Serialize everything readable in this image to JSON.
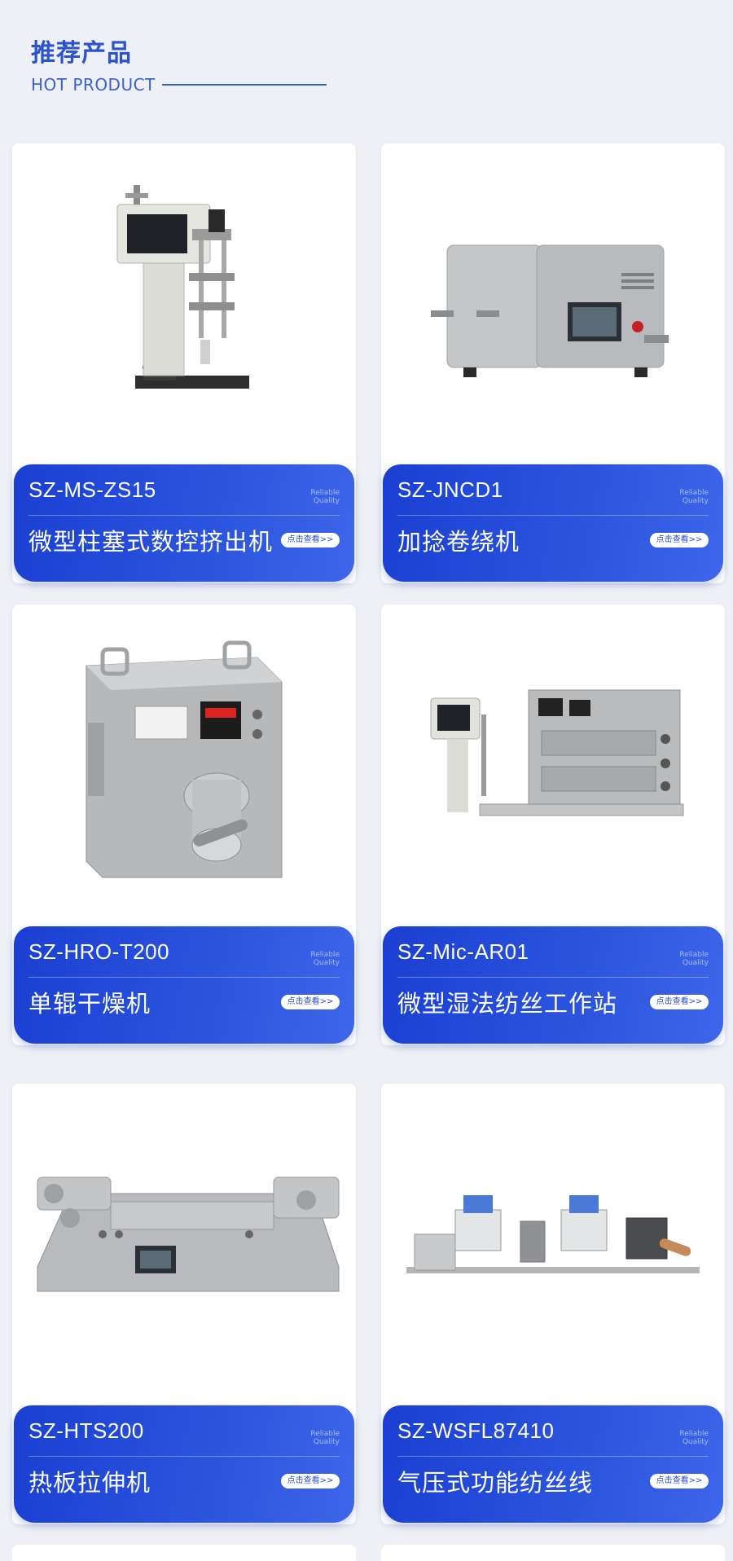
{
  "section": {
    "title_cn": "推荐产品",
    "title_en": "HOT PRODUCT"
  },
  "products": [
    {
      "model": "SZ-MS-ZS15",
      "name": "微型柱塞式数控挤出机",
      "tag_line1": "Reliable",
      "tag_line2": "Quality",
      "button": "点击查看>>"
    },
    {
      "model": "SZ-JNCD1",
      "name": "加捻卷绕机",
      "tag_line1": "Reliable",
      "tag_line2": "Quality",
      "button": "点击查看>>"
    },
    {
      "model": "SZ-HRO-T200",
      "name": "单辊干燥机",
      "tag_line1": "Reliable",
      "tag_line2": "Quality",
      "button": "点击查看>>"
    },
    {
      "model": "SZ-Mic-AR01",
      "name": "微型湿法纺丝工作站",
      "tag_line1": "Reliable",
      "tag_line2": "Quality",
      "button": "点击查看>>"
    },
    {
      "model": "SZ-HTS200",
      "name": "热板拉伸机",
      "tag_line1": "Reliable",
      "tag_line2": "Quality",
      "button": "点击查看>>"
    },
    {
      "model": "SZ-WSFL87410",
      "name": "气压式功能纺丝线",
      "tag_line1": "Reliable",
      "tag_line2": "Quality",
      "button": "点击查看>>"
    }
  ],
  "colors": {
    "accent": "#2b54cc",
    "panel_start": "#1a3fd2",
    "panel_end": "#3d66ea",
    "background": "#eef0f5"
  }
}
